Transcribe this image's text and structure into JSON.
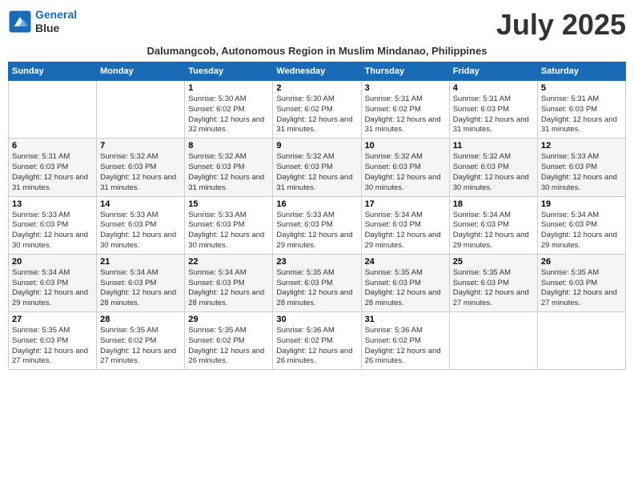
{
  "logo": {
    "line1": "General",
    "line2": "Blue"
  },
  "title": "July 2025",
  "subtitle": "Dalumangcob, Autonomous Region in Muslim Mindanao, Philippines",
  "days_of_week": [
    "Sunday",
    "Monday",
    "Tuesday",
    "Wednesday",
    "Thursday",
    "Friday",
    "Saturday"
  ],
  "weeks": [
    [
      {
        "day": "",
        "info": ""
      },
      {
        "day": "",
        "info": ""
      },
      {
        "day": "1",
        "info": "Sunrise: 5:30 AM\nSunset: 6:02 PM\nDaylight: 12 hours and 32 minutes."
      },
      {
        "day": "2",
        "info": "Sunrise: 5:30 AM\nSunset: 6:02 PM\nDaylight: 12 hours and 31 minutes."
      },
      {
        "day": "3",
        "info": "Sunrise: 5:31 AM\nSunset: 6:02 PM\nDaylight: 12 hours and 31 minutes."
      },
      {
        "day": "4",
        "info": "Sunrise: 5:31 AM\nSunset: 6:03 PM\nDaylight: 12 hours and 31 minutes."
      },
      {
        "day": "5",
        "info": "Sunrise: 5:31 AM\nSunset: 6:03 PM\nDaylight: 12 hours and 31 minutes."
      }
    ],
    [
      {
        "day": "6",
        "info": "Sunrise: 5:31 AM\nSunset: 6:03 PM\nDaylight: 12 hours and 31 minutes."
      },
      {
        "day": "7",
        "info": "Sunrise: 5:32 AM\nSunset: 6:03 PM\nDaylight: 12 hours and 31 minutes."
      },
      {
        "day": "8",
        "info": "Sunrise: 5:32 AM\nSunset: 6:03 PM\nDaylight: 12 hours and 31 minutes."
      },
      {
        "day": "9",
        "info": "Sunrise: 5:32 AM\nSunset: 6:03 PM\nDaylight: 12 hours and 31 minutes."
      },
      {
        "day": "10",
        "info": "Sunrise: 5:32 AM\nSunset: 6:03 PM\nDaylight: 12 hours and 30 minutes."
      },
      {
        "day": "11",
        "info": "Sunrise: 5:32 AM\nSunset: 6:03 PM\nDaylight: 12 hours and 30 minutes."
      },
      {
        "day": "12",
        "info": "Sunrise: 5:33 AM\nSunset: 6:03 PM\nDaylight: 12 hours and 30 minutes."
      }
    ],
    [
      {
        "day": "13",
        "info": "Sunrise: 5:33 AM\nSunset: 6:03 PM\nDaylight: 12 hours and 30 minutes."
      },
      {
        "day": "14",
        "info": "Sunrise: 5:33 AM\nSunset: 6:03 PM\nDaylight: 12 hours and 30 minutes."
      },
      {
        "day": "15",
        "info": "Sunrise: 5:33 AM\nSunset: 6:03 PM\nDaylight: 12 hours and 30 minutes."
      },
      {
        "day": "16",
        "info": "Sunrise: 5:33 AM\nSunset: 6:03 PM\nDaylight: 12 hours and 29 minutes."
      },
      {
        "day": "17",
        "info": "Sunrise: 5:34 AM\nSunset: 6:03 PM\nDaylight: 12 hours and 29 minutes."
      },
      {
        "day": "18",
        "info": "Sunrise: 5:34 AM\nSunset: 6:03 PM\nDaylight: 12 hours and 29 minutes."
      },
      {
        "day": "19",
        "info": "Sunrise: 5:34 AM\nSunset: 6:03 PM\nDaylight: 12 hours and 29 minutes."
      }
    ],
    [
      {
        "day": "20",
        "info": "Sunrise: 5:34 AM\nSunset: 6:03 PM\nDaylight: 12 hours and 29 minutes."
      },
      {
        "day": "21",
        "info": "Sunrise: 5:34 AM\nSunset: 6:03 PM\nDaylight: 12 hours and 28 minutes."
      },
      {
        "day": "22",
        "info": "Sunrise: 5:34 AM\nSunset: 6:03 PM\nDaylight: 12 hours and 28 minutes."
      },
      {
        "day": "23",
        "info": "Sunrise: 5:35 AM\nSunset: 6:03 PM\nDaylight: 12 hours and 28 minutes."
      },
      {
        "day": "24",
        "info": "Sunrise: 5:35 AM\nSunset: 6:03 PM\nDaylight: 12 hours and 28 minutes."
      },
      {
        "day": "25",
        "info": "Sunrise: 5:35 AM\nSunset: 6:03 PM\nDaylight: 12 hours and 27 minutes."
      },
      {
        "day": "26",
        "info": "Sunrise: 5:35 AM\nSunset: 6:03 PM\nDaylight: 12 hours and 27 minutes."
      }
    ],
    [
      {
        "day": "27",
        "info": "Sunrise: 5:35 AM\nSunset: 6:03 PM\nDaylight: 12 hours and 27 minutes."
      },
      {
        "day": "28",
        "info": "Sunrise: 5:35 AM\nSunset: 6:02 PM\nDaylight: 12 hours and 27 minutes."
      },
      {
        "day": "29",
        "info": "Sunrise: 5:35 AM\nSunset: 6:02 PM\nDaylight: 12 hours and 26 minutes."
      },
      {
        "day": "30",
        "info": "Sunrise: 5:36 AM\nSunset: 6:02 PM\nDaylight: 12 hours and 26 minutes."
      },
      {
        "day": "31",
        "info": "Sunrise: 5:36 AM\nSunset: 6:02 PM\nDaylight: 12 hours and 26 minutes."
      },
      {
        "day": "",
        "info": ""
      },
      {
        "day": "",
        "info": ""
      }
    ]
  ]
}
